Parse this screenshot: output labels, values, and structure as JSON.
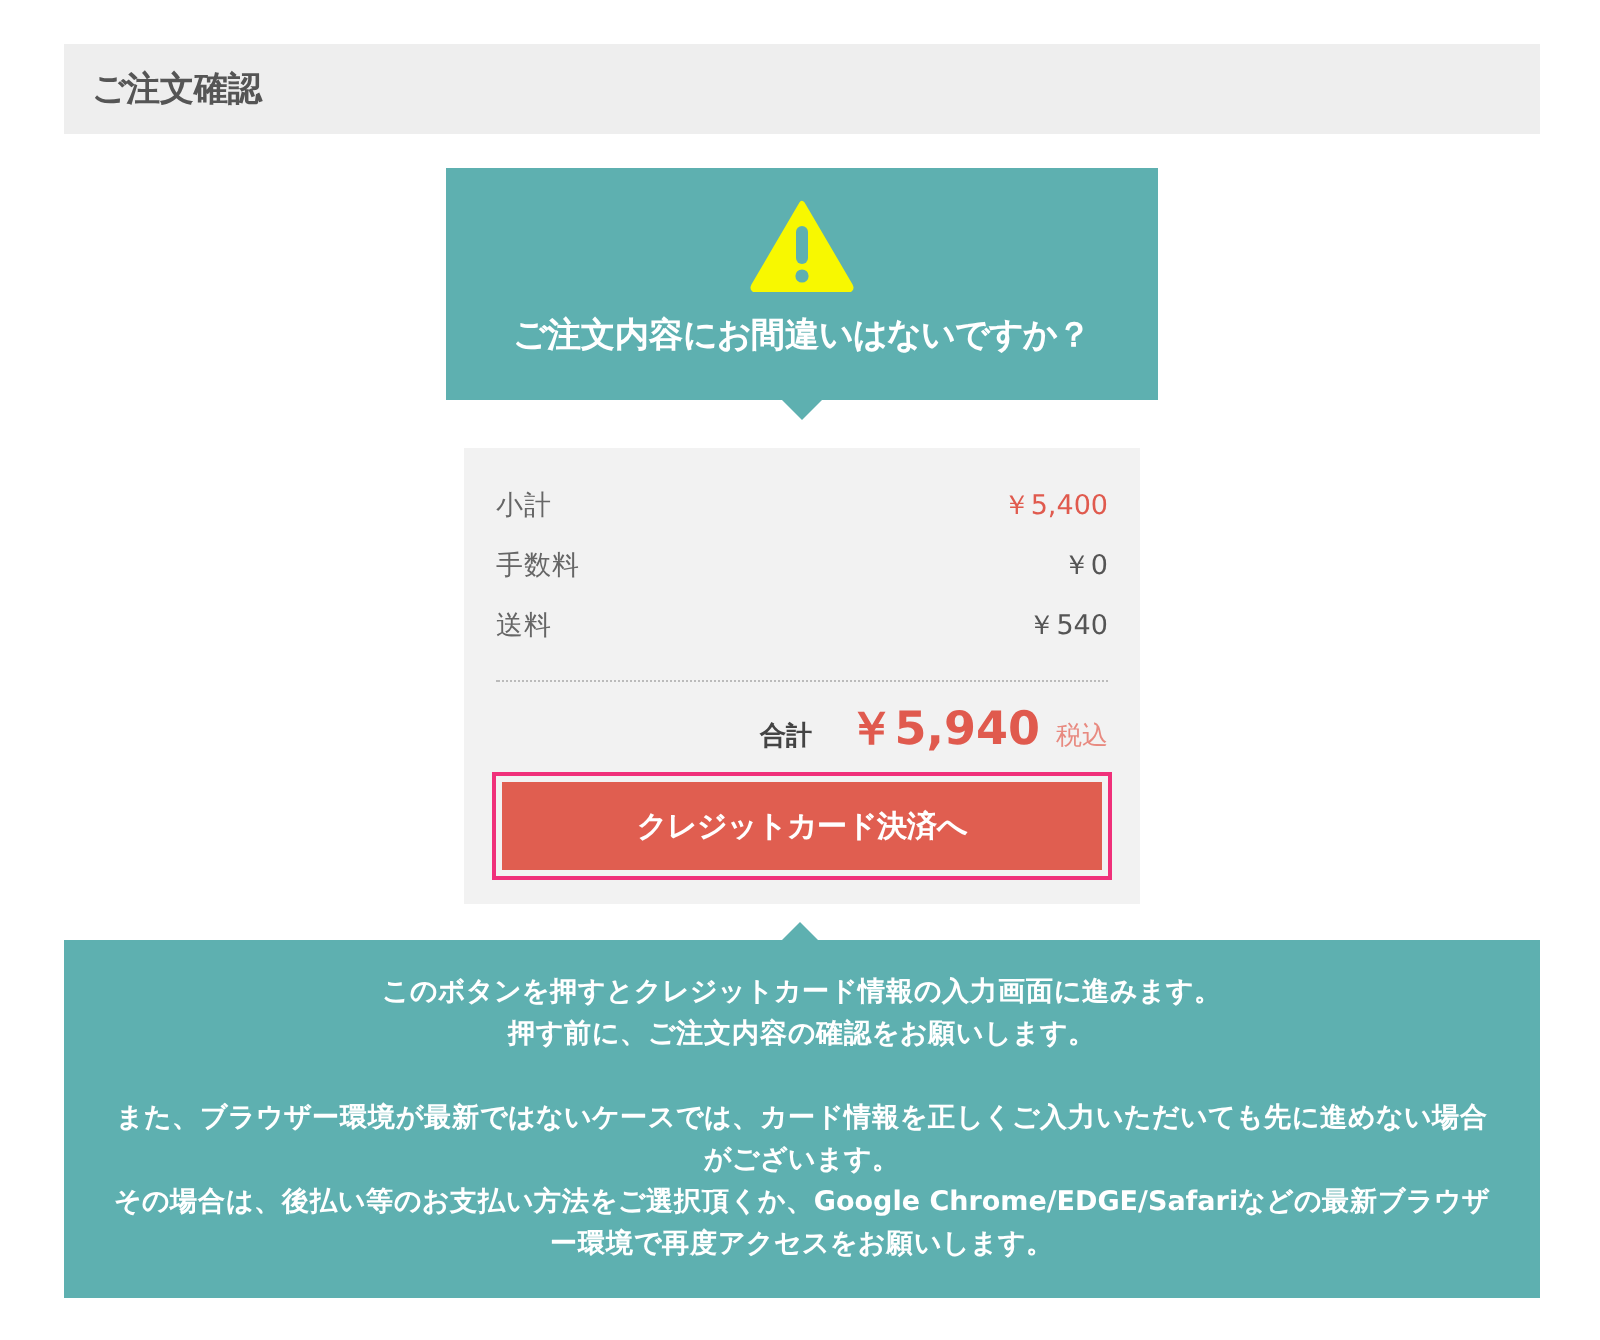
{
  "heading": "ご注文確認",
  "alert": {
    "title": "ご注文内容にお間違いはないですか？"
  },
  "summary": {
    "rows": [
      {
        "label": "小計",
        "value": "￥5,400",
        "color": "#e05a4e"
      },
      {
        "label": "手数料",
        "value": "￥0",
        "color": "#555555"
      },
      {
        "label": "送料",
        "value": "￥540",
        "color": "#555555"
      }
    ],
    "total": {
      "label": "合計",
      "value": "￥5,940",
      "note": "税込"
    }
  },
  "pay_button": {
    "label": "クレジットカード決済へ",
    "focused": true
  },
  "notice": {
    "paragraphs": [
      [
        "このボタンを押すとクレジットカード情報の入力画面に進みます。",
        "押す前に、ご注文内容の確認をお願いします。"
      ],
      [
        "また、ブラウザー環境が最新ではないケースでは、カード情報を正しくご入力いただいても先に進めない場合がございます。",
        "その場合は、後払い等のお支払い方法をご選択頂くか、Google Chrome/EDGE/Safariなどの最新ブラウザー環境で再度アクセスをお願いします。"
      ]
    ]
  }
}
